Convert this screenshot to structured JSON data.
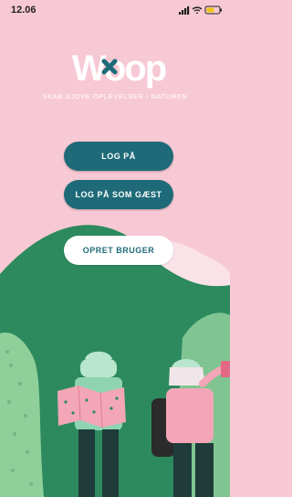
{
  "status_bar": {
    "time": "12.06",
    "icons": [
      "signal-icon",
      "wifi-icon",
      "battery-icon"
    ]
  },
  "brand": {
    "logo_text": "Woop",
    "tagline": "SKAB SJOVE OPLEVELSER I NATUREN"
  },
  "buttons": {
    "login": "LOG PÅ",
    "guest_login": "LOG PÅ SOM GÆST",
    "create_user": "OPRET BRUGER"
  },
  "colors": {
    "background": "#f7c9d4",
    "primary_button": "#1e6a78",
    "hill_dark": "#2c8a5e",
    "hill_light": "#8fcf9a"
  }
}
